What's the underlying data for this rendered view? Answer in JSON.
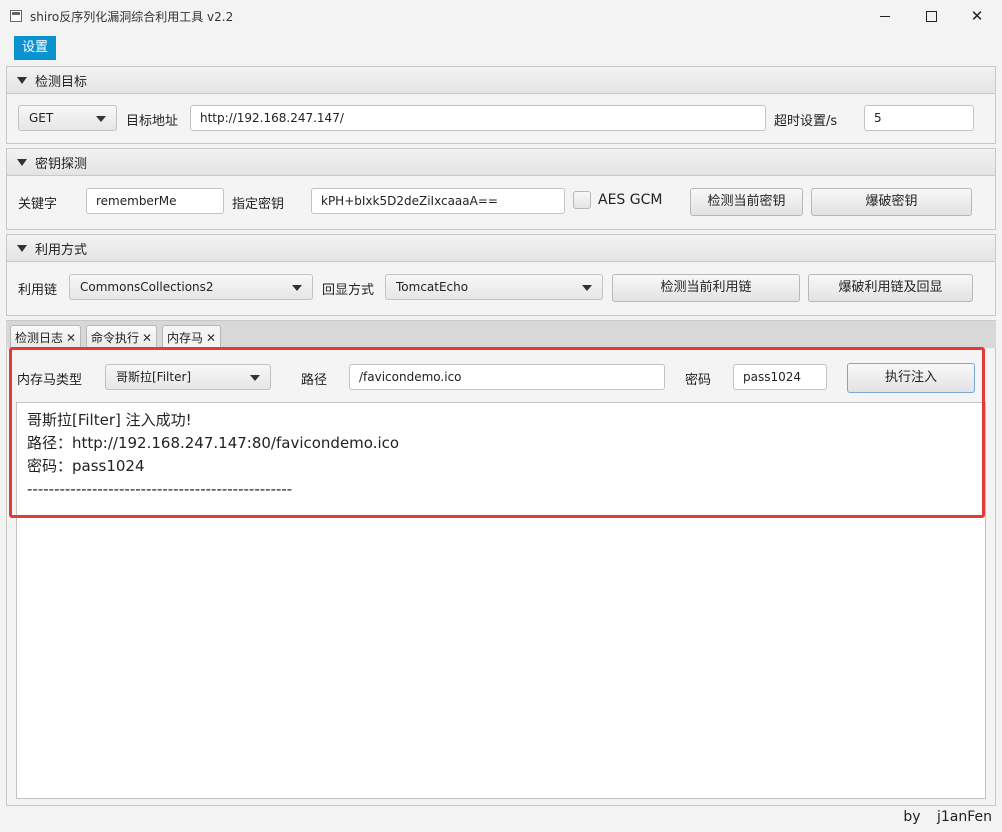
{
  "window": {
    "title": "shiro反序列化漏洞综合利用工具 v2.2"
  },
  "menu": {
    "settings_label": "设置"
  },
  "sections": {
    "target": {
      "title": "检测目标",
      "method": "GET",
      "url_label": "目标地址",
      "url_value": "http://192.168.247.147/",
      "timeout_label": "超时设置/s",
      "timeout_value": "5"
    },
    "key": {
      "title": "密钥探测",
      "keyword_label": "关键字",
      "keyword_value": "rememberMe",
      "specify_key_label": "指定密钥",
      "specify_key_value": "kPH+bIxk5D2deZiIxcaaaA==",
      "aes_gcm_label": "AES GCM",
      "check_key_button": "检测当前密钥",
      "bruteforce_key_button": "爆破密钥"
    },
    "exploit": {
      "title": "利用方式",
      "chain_label": "利用链",
      "chain_value": "CommonsCollections2",
      "echo_label": "回显方式",
      "echo_value": "TomcatEcho",
      "check_chain_button": "检测当前利用链",
      "bruteforce_chain_button": "爆破利用链及回显"
    }
  },
  "tabs": [
    {
      "label": "检测日志",
      "close": "✕"
    },
    {
      "label": "命令执行",
      "close": "✕"
    },
    {
      "label": "内存马",
      "close": "✕"
    }
  ],
  "memshell": {
    "type_label": "内存马类型",
    "type_value": "哥斯拉[Filter]",
    "path_label": "路径",
    "path_value": "/favicondemo.ico",
    "password_label": "密码",
    "password_value": "pass1024",
    "inject_button": "执行注入",
    "output_lines": [
      "哥斯拉[Filter]  注入成功!",
      "路径：http://192.168.247.147:80/favicondemo.ico",
      "密码：pass1024",
      "-------------------------------------------------"
    ]
  },
  "footer": {
    "text": "by j1anFen"
  },
  "colors": {
    "accent": "#0a93d1",
    "highlight": "#e53935"
  }
}
